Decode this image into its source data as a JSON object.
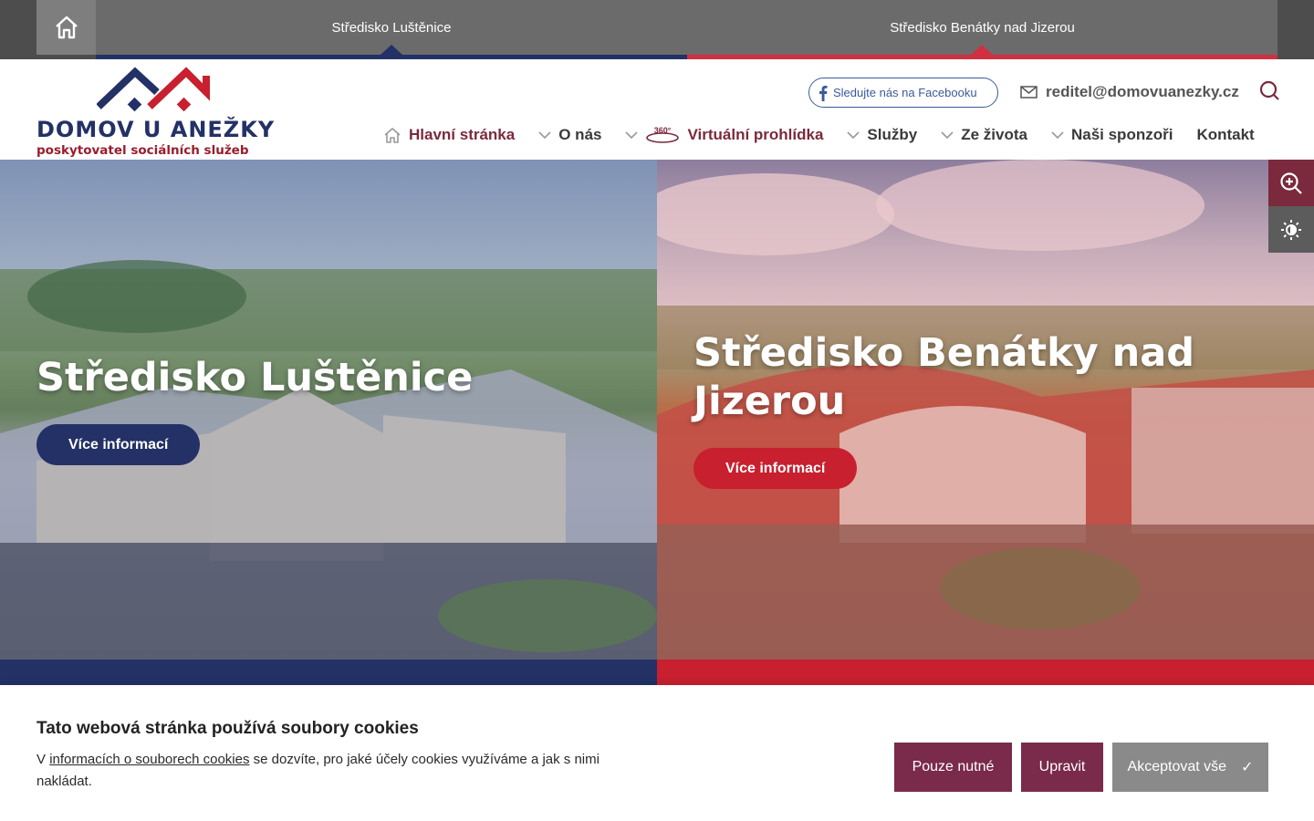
{
  "topbar": {
    "tabs": [
      {
        "label": "Středisko Luštěnice",
        "accent": "#233166"
      },
      {
        "label": "Středisko Benátky nad Jizerou",
        "accent": "#d03040"
      }
    ]
  },
  "logo": {
    "name": "DOMOV U ANEŽKY",
    "subtitle": "poskytovatel sociálních služeb"
  },
  "header": {
    "facebook_label": "Sledujte nás na Facebooku",
    "email": "reditel@domovuanezky.cz"
  },
  "nav": {
    "items": [
      {
        "label": "Hlavní stránka",
        "icon": "home-icon"
      },
      {
        "label": "O nás",
        "icon": "chevron-down-icon"
      },
      {
        "label": "Virtuální prohlídka",
        "icon": "360-icon",
        "badge": "360°"
      },
      {
        "label": "Služby",
        "icon": "chevron-down-icon"
      },
      {
        "label": "Ze života",
        "icon": "chevron-down-icon"
      },
      {
        "label": "Naši sponzoři",
        "icon": "chevron-down-icon"
      },
      {
        "label": "Kontakt"
      }
    ]
  },
  "hero": {
    "left": {
      "title": "Středisko Luštěnice",
      "button": "Více informací",
      "color": "#233166"
    },
    "right": {
      "title": "Středisko Benátky nad Jizerou",
      "button": "Více informací",
      "color": "#c8202f"
    }
  },
  "tools": {
    "zoom_icon": "zoom-in-icon",
    "contrast_icon": "brightness-icon"
  },
  "cookies": {
    "title": "Tato webová stránka používá soubory cookies",
    "text_before": "V ",
    "link": "informacích o souborech cookies",
    "text_after": " se dozvíte, pro jaké účely cookies využíváme a jak s nimi nakládat.",
    "btn_necessary": "Pouze nutné",
    "btn_edit": "Upravit",
    "btn_accept": "Akceptovat vše",
    "accept_mark": "✓"
  }
}
